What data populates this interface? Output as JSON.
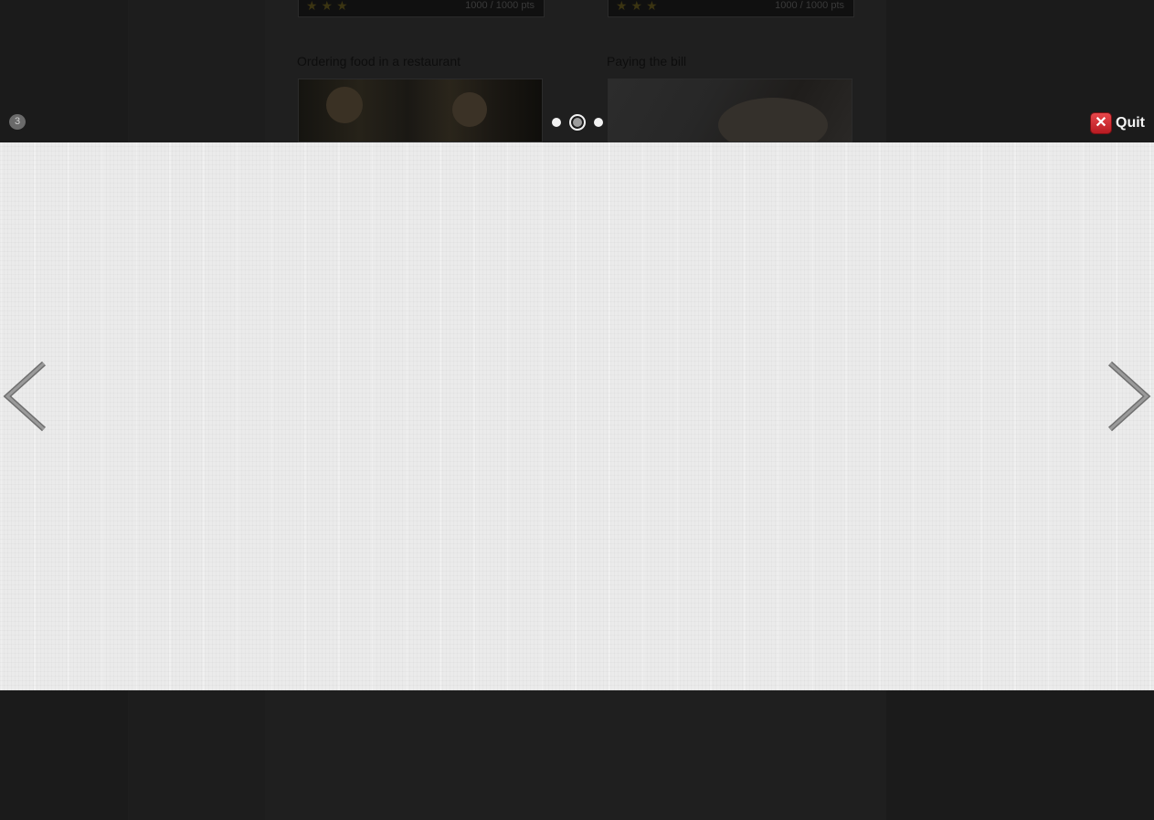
{
  "background_page": {
    "cards_top": [
      {
        "stars": "★★★",
        "points": "1000 / 1000 pts"
      },
      {
        "stars": "★★★",
        "points": "1000 / 1000 pts"
      }
    ],
    "lessons": [
      {
        "title": "Ordering food in a restaurant"
      },
      {
        "title": "Paying the bill"
      }
    ]
  },
  "overlay": {
    "page_number": "3",
    "quit_label": "Quit",
    "pagination": {
      "count": 3,
      "active_index": 1
    }
  },
  "icons": {
    "prev": "chevron-left-icon",
    "next": "chevron-right-icon",
    "quit": "close-icon"
  },
  "colors": {
    "panel_bg": "#ebebeb",
    "overlay_bg": "#1b1b1b",
    "quit_red": "#d02c33",
    "arrow_grey": "#8a8a8a"
  }
}
